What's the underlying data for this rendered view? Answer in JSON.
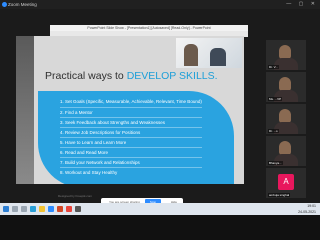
{
  "zoom_window": {
    "title": "Zoom Meeting",
    "controls": "—  ▢  ✕"
  },
  "powerpoint": {
    "title": "PowerPoint Slide Show - [Presentation1] [Autosaved] [Read-Only] - PowerPoint",
    "status": "▭  ⊞  ⌂"
  },
  "slide": {
    "heading_prefix": "Practical ways to ",
    "heading_highlight": "DEVELOP SKILLS.",
    "items": [
      "1.   Set Goals (Specific, Measurable, Achievable, Relevant, Time Bound)",
      "2.   Find a Mentor",
      "3.   Seek Feedback about Strengths and Weaknesses",
      "4.   Review Job Descriptions for Positions",
      "5.   Have to Learn and Learn More",
      "6.   Read and Read More",
      "7.   Build your Network and Relationships",
      "8.   Workout and Stay Healthy"
    ],
    "footer": "Designed by Freepik.com",
    "accent": "#2aa3e0"
  },
  "share_notice": {
    "text": "You are screen sharing",
    "stop_label": "Stop Sharing",
    "hide_label": "Hide"
  },
  "participants": [
    {
      "name": "Dr. V..."
    },
    {
      "name": "Ms. ...VP"
    },
    {
      "name": "Dr. ...s"
    },
    {
      "name": "Bhavya..."
    },
    {
      "name": "ambuja singhal",
      "initial": "A"
    }
  ],
  "taskbar": {
    "time": "19:01",
    "date": "24-05-2021"
  }
}
